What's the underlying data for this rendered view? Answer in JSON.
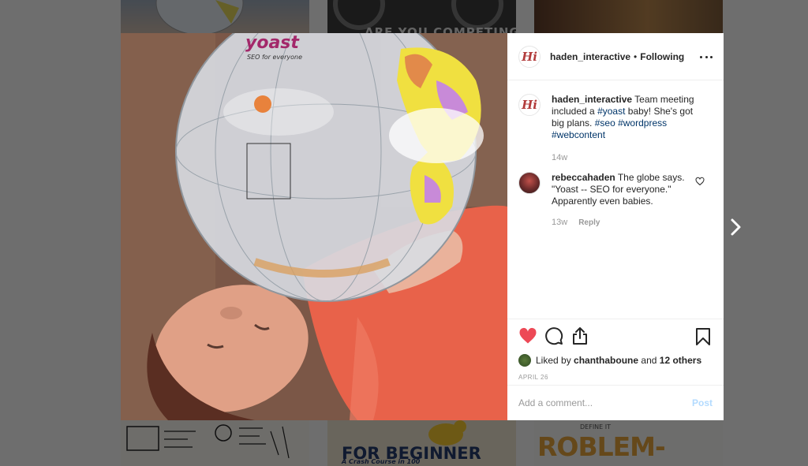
{
  "background_tiles": {
    "tile_2_text": "ARE YOU COMPETING",
    "tile_5_text": "FOR BEGINNER",
    "tile_5_sub": "A Crash Course in 100",
    "tile_6_text": "ROBLEM-",
    "tile_6_small": "DEFINE IT"
  },
  "photo": {
    "globe_brand": "yoast",
    "globe_tagline": "SEO for everyone"
  },
  "header": {
    "username": "haden_interactive",
    "separator": "•",
    "follow_status": "Following",
    "avatar_logo": "Hi"
  },
  "caption": {
    "username": "haden_interactive",
    "text_before": "Team meeting included a",
    "tag_1": "#yoast",
    "text_after": "baby! She's got big plans.",
    "tag_2": "#seo",
    "tag_3": "#wordpress",
    "tag_4": "#webcontent",
    "age": "14w"
  },
  "comment": {
    "username": "rebeccahaden",
    "text": "The globe says. \"Yoast -- SEO for everyone.\" Apparently even babies.",
    "age": "13w",
    "reply_label": "Reply"
  },
  "likes": {
    "prefix": "Liked by",
    "user": "chanthaboune",
    "and": "and",
    "others": "12 others"
  },
  "post_date": "APRIL 26",
  "add_comment": {
    "placeholder": "Add a comment...",
    "post_label": "Post"
  },
  "colors": {
    "like_red": "#ed4956",
    "hashtag_blue": "#003569",
    "post_button_disabled": "#b3dbff"
  },
  "icons": [
    "heart-icon",
    "comment-icon",
    "share-icon",
    "bookmark-icon",
    "more-options-icon",
    "chevron-right-icon"
  ]
}
